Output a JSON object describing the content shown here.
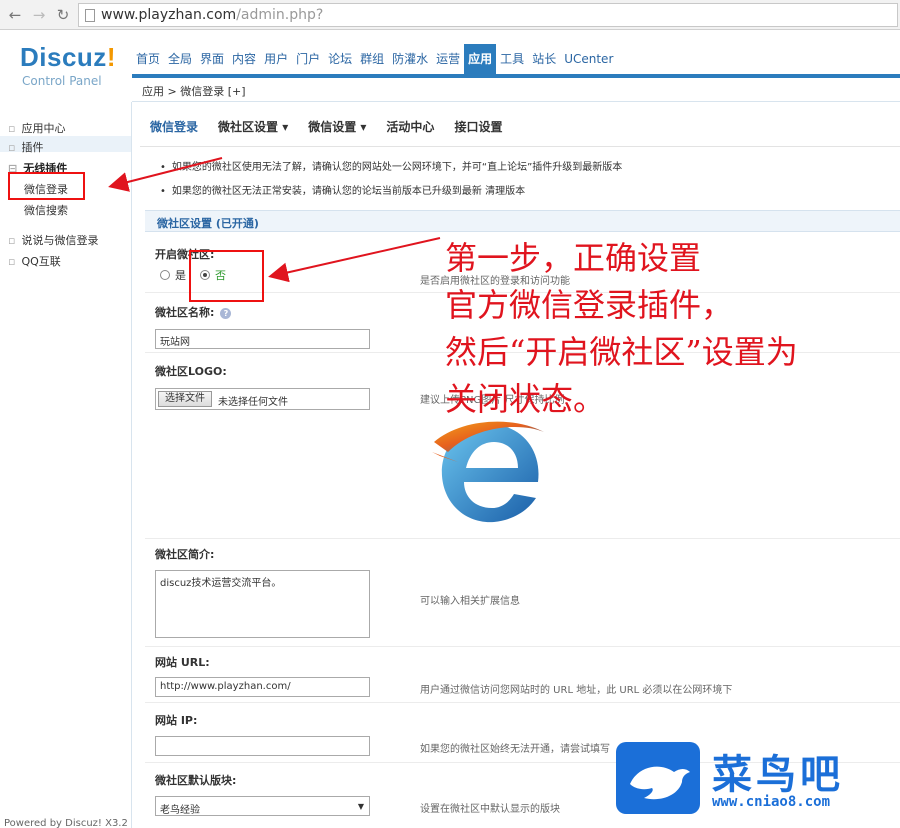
{
  "browser": {
    "url_host": "www.playzhan.com",
    "url_path": "/admin.php?"
  },
  "header": {
    "logo_main": "Discuz",
    "logo_bang": "!",
    "logo_sub": "Control Panel",
    "nav": [
      "首页",
      "全局",
      "界面",
      "内容",
      "用户",
      "门户",
      "论坛",
      "群组",
      "防灌水",
      "运营",
      "应用",
      "工具",
      "站长",
      "UCenter"
    ],
    "active_nav": "应用",
    "breadcrumb": "应用 > 微信登录 [+]"
  },
  "sidebar": {
    "items": [
      "应用中心",
      "插件",
      "无线插件",
      "微信登录",
      "微信搜索",
      "说说与微信登录",
      "QQ互联"
    ],
    "powered": "Powered by Discuz! X3.2"
  },
  "tabs": [
    "微信登录",
    "微社区设置 ▾",
    "微信设置 ▾",
    "活动中心",
    "接口设置"
  ],
  "tips": [
    "如果您的微社区使用无法了解，请确认您的网站处一公网环境下，并可“直上论坛”插件升级到最新版本",
    "如果您的微社区无法正常安装，请确认您的论坛当前版本已升级到最新 清理版本"
  ],
  "form": {
    "section_title": "微社区设置 (已开通)",
    "enable": {
      "label": "开启微社区:",
      "option_yes": "是",
      "option_no": "否",
      "desc": "是否启用微社区的登录和访问功能"
    },
    "name": {
      "label": "微社区名称:",
      "value": "玩站网"
    },
    "logo": {
      "label": "微社区LOGO:",
      "button": "选择文件",
      "file_text": "未选择任何文件",
      "desc": "建议上传PNG图片 尺寸保持比例"
    },
    "intro": {
      "label": "微社区简介:",
      "value": "discuz技术运营交流平台。",
      "desc": "可以输入相关扩展信息"
    },
    "url": {
      "label": "网站 URL:",
      "value": "http://www.playzhan.com/",
      "desc": "用户通过微信访问您网站时的 URL 地址，此 URL 必须以在公网环境下"
    },
    "ip": {
      "label": "网站 IP:",
      "value": "",
      "desc": "如果您的微社区始终无法开通，请尝试填写"
    },
    "default_section": {
      "label": "微社区默认版块:",
      "value": "老鸟经验",
      "desc": "设置在微社区中默认显示的版块"
    }
  },
  "annotation": [
    "第一步，正确设置",
    "官方微信登录插件，",
    "然后“开启微社区”设置为",
    "关闭状态。"
  ],
  "watermark": {
    "name": "菜鸟吧",
    "url": "www.cniao8.com"
  },
  "colors": {
    "brand_blue": "#2b7cbd",
    "annotation_red": "#e0141e",
    "watermark_blue": "#1b6fd8"
  }
}
